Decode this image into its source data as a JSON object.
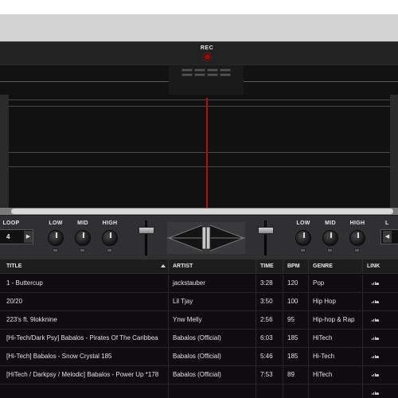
{
  "header": {
    "rec_label": "REC"
  },
  "mixer": {
    "loop_label": "LOOP",
    "loop_value": "4",
    "loop_right_label": "L",
    "eq_left": [
      "LOW",
      "MID",
      "HIGH"
    ],
    "eq_right": [
      "LOW",
      "MID",
      "HIGH"
    ]
  },
  "library": {
    "columns": [
      "TITLE",
      "ARTIST",
      "TIME",
      "BPM",
      "GENRE",
      "LINK"
    ],
    "rows": [
      {
        "title": "1 - Buttercup",
        "artist": "jackstauber",
        "time": "3:28",
        "bpm": "120",
        "genre": "Pop"
      },
      {
        "title": "20/20",
        "artist": "Lil Tjay",
        "time": "3:50",
        "bpm": "100",
        "genre": "Hip Hop"
      },
      {
        "title": "223's ft. 9lokknine",
        "artist": "Ynw Melly",
        "time": "2:56",
        "bpm": "95",
        "genre": "Hip-hop & Rap"
      },
      {
        "title": "[Hi-Tech/Dark Psy] Babalos - Pirates Of The Caribbea",
        "artist": "Babalos (Official)",
        "time": "6:03",
        "bpm": "185",
        "genre": "HiTech"
      },
      {
        "title": "[Hi-Tech] Babalos - Snow Crystal 185",
        "artist": "Babalos (Official)",
        "time": "5:46",
        "bpm": "185",
        "genre": "Hi-Tech"
      },
      {
        "title": "[HiTech / Darkpsy / Melodic] Babalos - Power Up *178",
        "artist": "Babalos (Official)",
        "time": "7:53",
        "bpm": "89",
        "genre": "HiTech"
      },
      {
        "title": "",
        "artist": "",
        "time": "",
        "bpm": "",
        "genre": ""
      }
    ],
    "link_icon": "soundcloud-icon"
  },
  "colors": {
    "playhead": "#b01010",
    "rec_button": "#8a1010",
    "library_bg": "#100b10"
  }
}
